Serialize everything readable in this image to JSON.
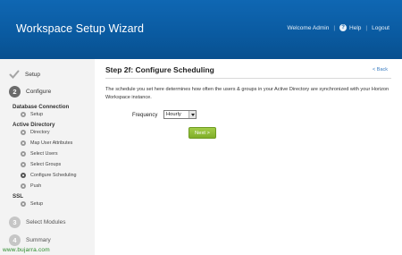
{
  "header": {
    "title": "Workspace Setup Wizard",
    "welcome": "Welcome Admin",
    "separator": "|",
    "help_icon_glyph": "?",
    "help": "Help",
    "logout": "Logout"
  },
  "sidebar": {
    "steps": [
      {
        "label": "Setup",
        "status": "done",
        "icon": "checkmark-icon"
      },
      {
        "number": "2",
        "label": "Configure",
        "status": "active"
      },
      {
        "number": "3",
        "label": "Select Modules",
        "status": "pending"
      },
      {
        "number": "4",
        "label": "Summary",
        "status": "pending"
      }
    ],
    "groups": [
      {
        "title": "Database Connection",
        "items": [
          "Setup"
        ]
      },
      {
        "title": "Active Directory",
        "items": [
          "Directory",
          "Map User Attributes",
          "Select Users",
          "Select Groups",
          "Configure Scheduling",
          "Push"
        ]
      },
      {
        "title": "SSL",
        "items": [
          "Setup"
        ]
      }
    ]
  },
  "main": {
    "title": "Step 2f: Configure Scheduling",
    "back": "< Back",
    "description": "The schedule you set here determines how often the users & groups in your Active Directory are synchronized with your Horizon Workspace instance.",
    "frequency_label": "Frequency",
    "frequency_value": "Hourly",
    "next_button": "Next >"
  },
  "watermark": "www.bujarra.com",
  "colors": {
    "header_bg": "#0a5aa0",
    "next_button": "#8ab930",
    "link": "#3a7cc0",
    "sidebar_bg": "#f3f3f3"
  }
}
